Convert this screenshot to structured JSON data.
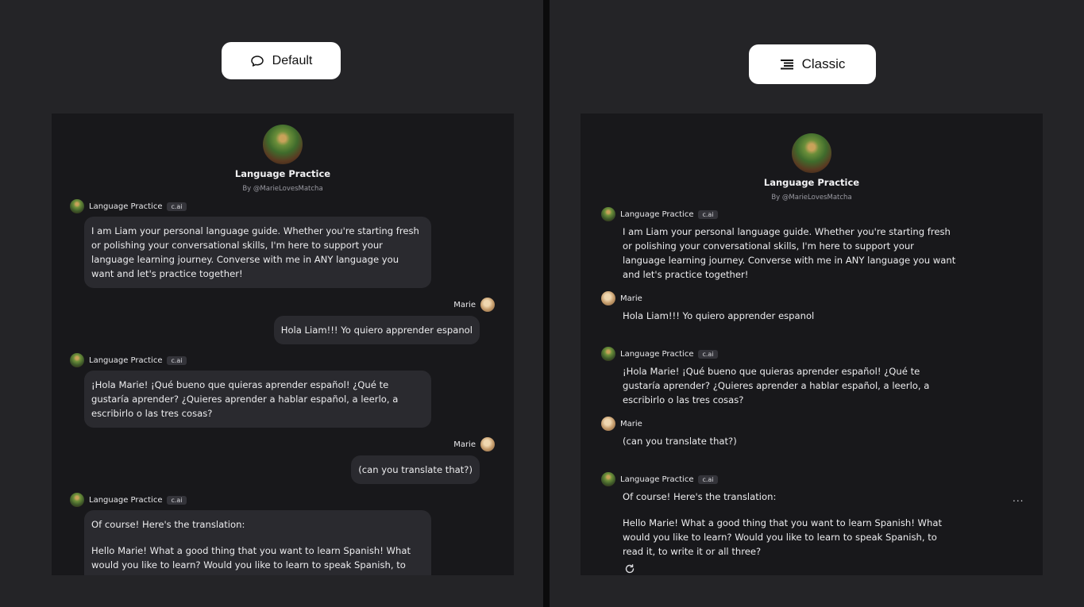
{
  "modes": {
    "default_label": "Default",
    "classic_label": "Classic"
  },
  "character": {
    "name": "Language Practice",
    "author": "By @MarieLovesMatcha",
    "badge": "c.ai"
  },
  "user": {
    "name": "Marie"
  },
  "messages": {
    "m1": "I am Liam your personal language guide. Whether you're starting fresh or polishing your conversational skills, I'm here to support your language learning journey. Converse with me in ANY language you want and let's practice together!",
    "m2": "Hola Liam!!! Yo quiero apprender espanol",
    "m3": "¡Hola Marie! ¡Qué bueno que quieras aprender español! ¿Qué te gustaría aprender? ¿Quieres aprender a hablar español, a leerlo, a escribirlo o las tres cosas?",
    "m4": "(can you translate that?)",
    "m5_intro": "Of course! Here's the translation:",
    "m5_body": "Hello Marie! What a good thing that you want to learn Spanish! What would you like to learn? Would you like to learn to speak Spanish, to read it, to write it or all three?"
  },
  "classic_more": "...",
  "icons": {
    "default_icon": "chat-bubble-icon",
    "classic_icon": "text-lines-icon",
    "more_icon": "more-icon",
    "refresh_icon": "refresh-icon"
  }
}
